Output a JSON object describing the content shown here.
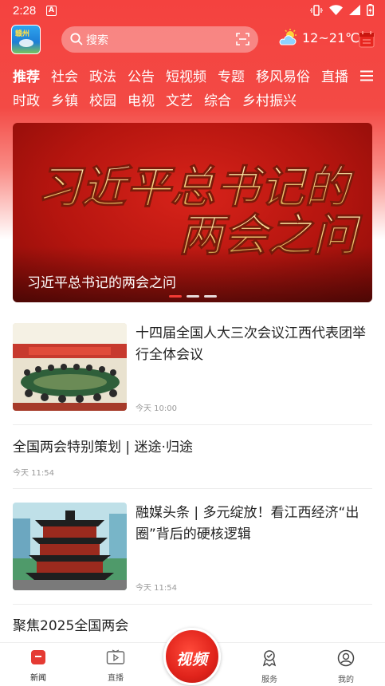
{
  "status_bar": {
    "time": "2:28",
    "notification_badge": "A"
  },
  "header": {
    "search_placeholder": "搜索",
    "weather": "12~21℃"
  },
  "tabs": {
    "row1": [
      "推荐",
      "社会",
      "政法",
      "公告",
      "短视频",
      "专题",
      "移风易俗",
      "直播"
    ],
    "row2": [
      "时政",
      "乡镇",
      "校园",
      "电视",
      "文艺",
      "综合",
      "乡村振兴"
    ],
    "active": "推荐"
  },
  "banner": {
    "line1": "习近平总书记的",
    "line2": "两会之问",
    "caption": "习近平总书记的两会之问",
    "dots": 3,
    "active_dot": 0
  },
  "news": [
    {
      "title": "十四届全国人大三次会议江西代表团举行全体会议",
      "time": "今天 10:00"
    },
    {
      "title": "全国两会特别策划 | 迷途·归途",
      "time": "今天 11:54"
    },
    {
      "title": "融媒头条 | 多元绽放！看江西经济“出圈”背后的硬核逻辑",
      "time": "今天 11:54"
    },
    {
      "title": "聚焦2025全国两会"
    }
  ],
  "bottom_nav": {
    "items": [
      "新闻",
      "直播",
      "视频",
      "服务",
      "我的"
    ],
    "active": "新闻"
  },
  "colors": {
    "brand_red": "#f4423f",
    "text": "#222222",
    "muted": "#999999"
  }
}
